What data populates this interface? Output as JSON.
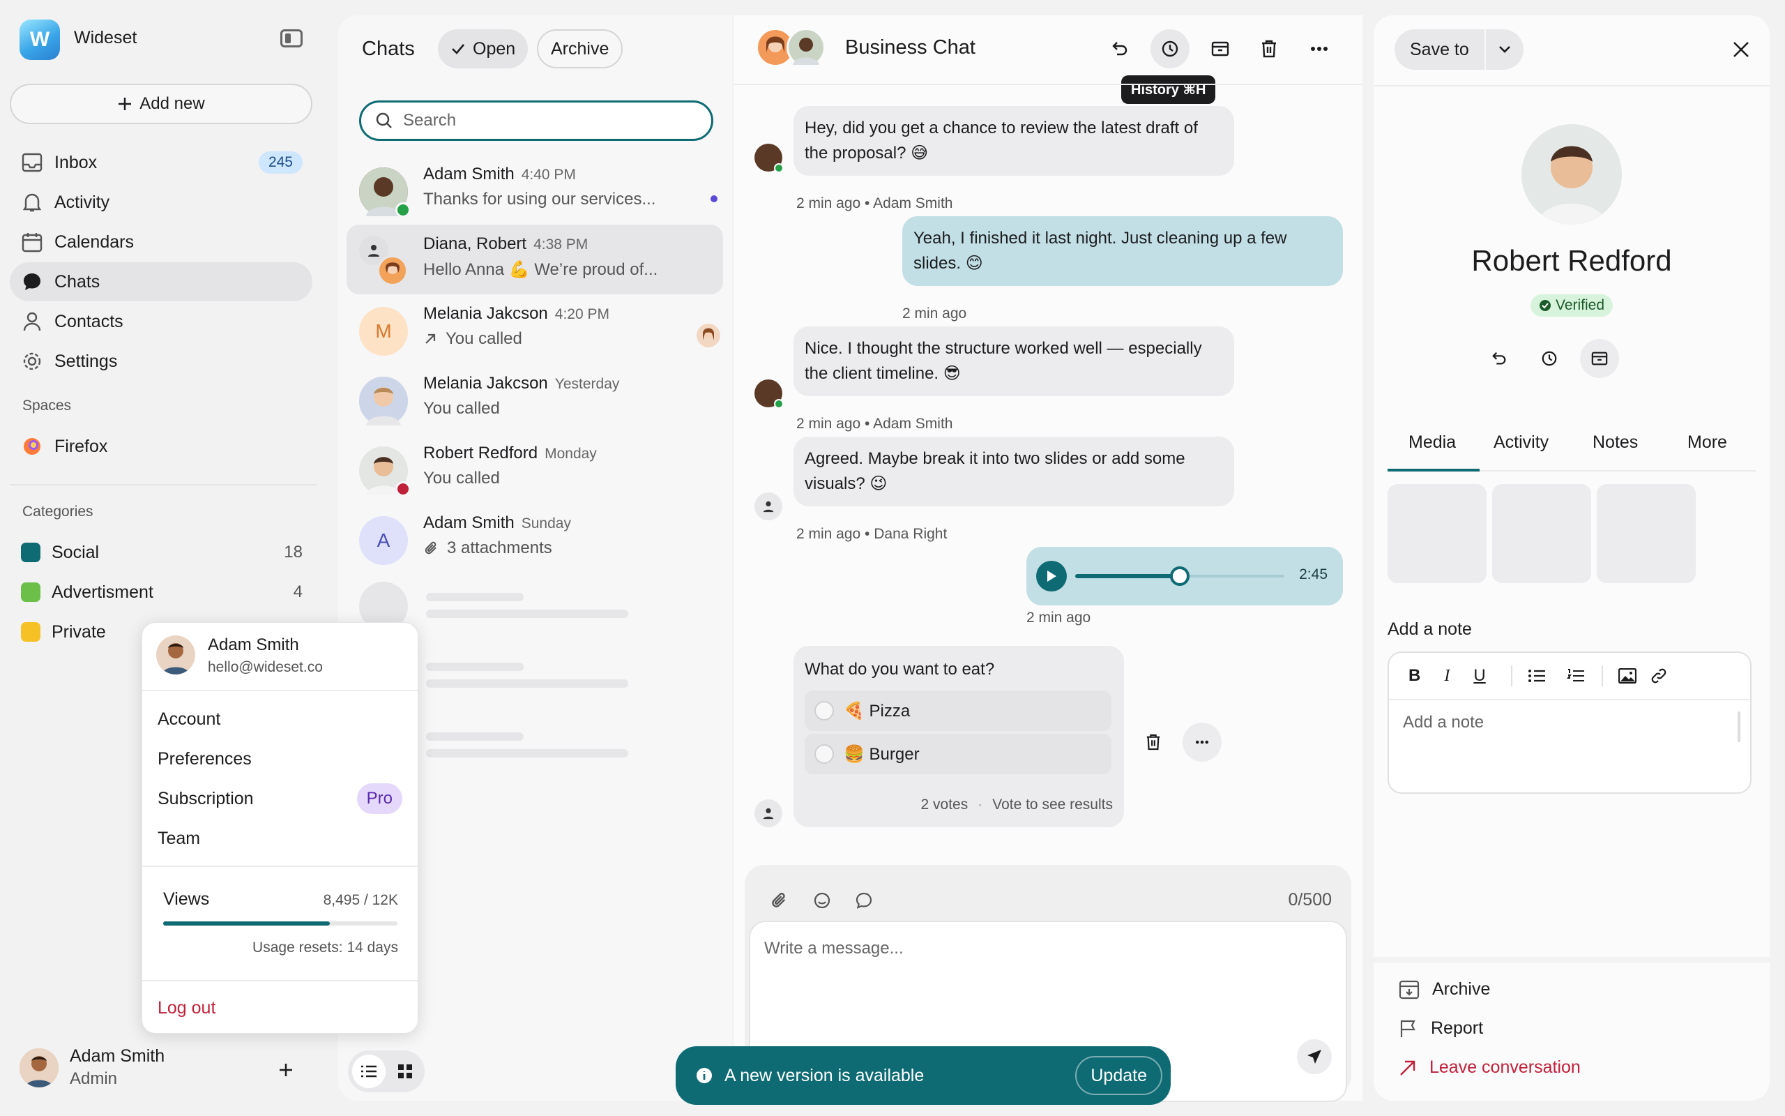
{
  "app": {
    "brand": "Wideset",
    "logo_letter": "W"
  },
  "sidebar": {
    "add_new": "Add new",
    "nav": [
      {
        "label": "Inbox",
        "icon": "inbox-icon",
        "count": "245"
      },
      {
        "label": "Activity",
        "icon": "bell-icon"
      },
      {
        "label": "Calendars",
        "icon": "calendar-icon"
      },
      {
        "label": "Chats",
        "icon": "chat-bubble-icon",
        "active": true
      },
      {
        "label": "Contacts",
        "icon": "person-icon"
      },
      {
        "label": "Settings",
        "icon": "gear-icon"
      }
    ],
    "spaces_label": "Spaces",
    "spaces": [
      {
        "label": "Firefox",
        "icon": "firefox-icon"
      }
    ],
    "categories_label": "Categories",
    "categories": [
      {
        "label": "Social",
        "count": "18",
        "color": "#0f6b73"
      },
      {
        "label": "Advertisment",
        "count": "4",
        "color": "#6cc04a"
      },
      {
        "label": "Private",
        "count": "",
        "color": "#f5c125"
      }
    ],
    "user": {
      "name": "Adam Smith",
      "role": "Admin"
    }
  },
  "popover": {
    "name": "Adam Smith",
    "email": "hello@wideset.co",
    "items": [
      "Account",
      "Preferences",
      "Subscription",
      "Team"
    ],
    "pro_badge": "Pro",
    "views_label": "Views",
    "views_value": "8,495 / 12K",
    "views_fraction": 0.71,
    "usage_reset": "Usage resets: 14 days",
    "logout": "Log out"
  },
  "list": {
    "title": "Chats",
    "filter_open": "Open",
    "filter_archive": "Archive",
    "search_placeholder": "Search",
    "chats": [
      {
        "name": "Adam Smith",
        "time": "4:40 PM",
        "preview": "Thanks for using our services..."
      },
      {
        "name": "Diana, Robert",
        "time": "4:38 PM",
        "preview": "Hello Anna 💪 We’re proud of..."
      },
      {
        "name": "Melania Jakcson",
        "time": "4:20 PM",
        "preview": "You called",
        "initial": "M"
      },
      {
        "name": "Melania Jakcson",
        "time": "Yesterday",
        "preview": "You called"
      },
      {
        "name": "Robert Redford",
        "time": "Monday",
        "preview": "You called"
      },
      {
        "name": "Adam Smith",
        "time": "Sunday",
        "preview": "3 attachments",
        "initial": "A"
      }
    ]
  },
  "chat": {
    "title": "Business Chat",
    "tooltip": "History ⌘H",
    "messages": [
      {
        "text": "Hey, did you get a chance to review the latest draft of the proposal? 😅",
        "meta": "2 min ago • Adam Smith"
      },
      {
        "text": "Yeah, I finished it last night. Just cleaning up a few slides. 😊",
        "meta": "2 min ago"
      },
      {
        "text": "Nice. I thought the structure worked well — especially the client timeline. 😎",
        "meta": "2 min ago • Adam Smith"
      },
      {
        "text": "Agreed. Maybe break it into two slides or add some visuals? 😉",
        "meta": "2 min ago • Dana Right"
      }
    ],
    "voice": {
      "duration": "2:45",
      "meta": "2 min ago",
      "progress": 0.5
    },
    "poll": {
      "question": "What do you want to eat?",
      "options": [
        "🍕 Pizza",
        "🍔 Burger"
      ],
      "votes": "2 votes",
      "vote_hint": "Vote to see results"
    },
    "composer": {
      "counter": "0/500",
      "placeholder": "Write a message..."
    },
    "toast": {
      "text": "A new version is available",
      "button": "Update"
    }
  },
  "detail": {
    "save_to": "Save to",
    "name": "Robert Redford",
    "verified": "Verified",
    "tabs": [
      "Media",
      "Activity",
      "Notes",
      "More"
    ],
    "note_label": "Add a note",
    "note_placeholder": "Add a note",
    "actions": [
      "Archive",
      "Report",
      "Leave conversation"
    ]
  },
  "colors": {
    "accent": "#0f6b73",
    "danger": "#c0213a",
    "bubble_out": "#c2dfe6"
  }
}
